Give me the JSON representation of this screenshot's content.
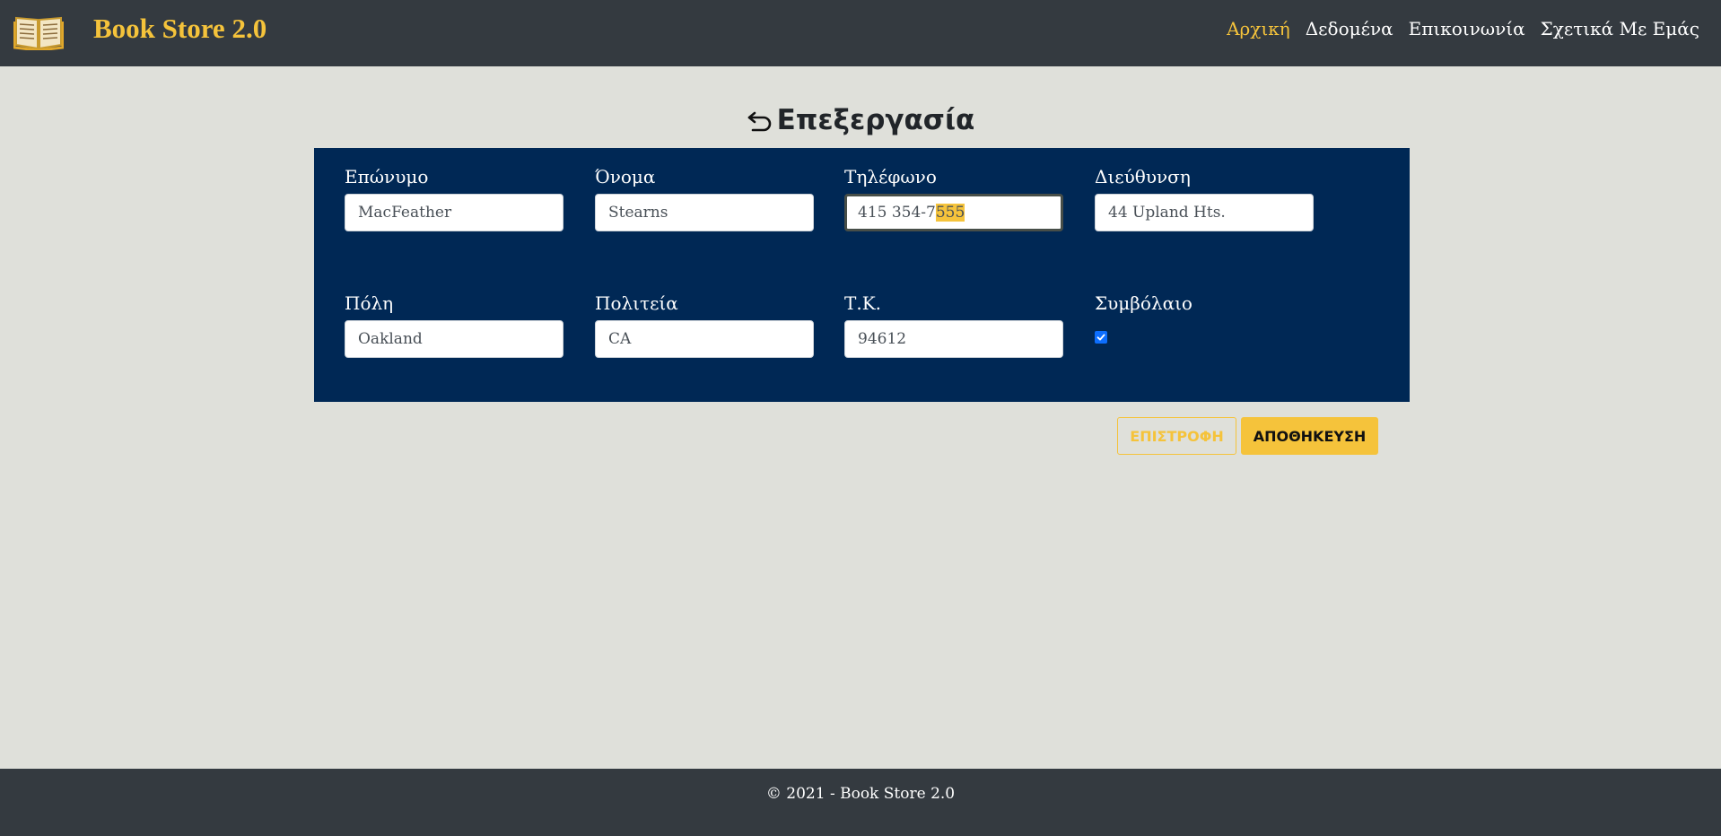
{
  "navbar": {
    "brand_title": "Book Store 2.0",
    "brand_icon": "open-book-icon",
    "links": [
      {
        "label": "Αρχική",
        "active": true
      },
      {
        "label": "Δεδομένα",
        "active": false
      },
      {
        "label": "Επικοινωνία",
        "active": false
      },
      {
        "label": "Σχετικά Με Εμάς",
        "active": false
      }
    ]
  },
  "page": {
    "title": "Επεξεργασία",
    "back_icon": "return-arrow-icon"
  },
  "form": {
    "last_name": {
      "label": "Επώνυμο",
      "value": "MacFeather"
    },
    "first_name": {
      "label": "Όνομα",
      "value": "Stearns"
    },
    "phone": {
      "label": "Τηλέφωνο",
      "value": "415 354-7555",
      "value_unselected": "415 354-7",
      "value_selected": "555"
    },
    "address": {
      "label": "Διεύθυνση",
      "value": "44 Upland Hts."
    },
    "city": {
      "label": "Πόλη",
      "value": "Oakland"
    },
    "state": {
      "label": "Πολιτεία",
      "value": "CA"
    },
    "zip": {
      "label": "Τ.Κ.",
      "value": "94612"
    },
    "contract": {
      "label": "Συμβόλαιο",
      "checked": true
    }
  },
  "actions": {
    "back_label": "ΕΠΙΣΤΡΟΦΗ",
    "save_label": "ΑΠΟΘΗΚΕΥΣΗ"
  },
  "footer": {
    "text": "© 2021 - Book Store 2.0"
  },
  "colors": {
    "accent": "#f5c33b",
    "navbar": "#343a40",
    "panel": "#002855",
    "background": "#dfe0da"
  }
}
